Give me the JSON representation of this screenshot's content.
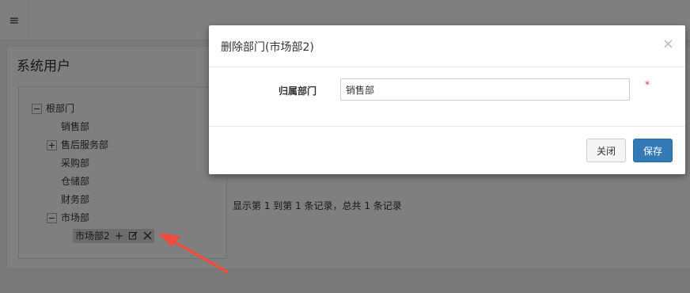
{
  "topbar": {
    "menu_icon": "hamburger-icon",
    "menu_glyph": "≡"
  },
  "page": {
    "title": "系统用户"
  },
  "tree": {
    "root": "根部门",
    "items": [
      "销售部",
      "售后服务部",
      "采购部",
      "仓储部",
      "财务部",
      "市场部"
    ],
    "selected_child": "市场部2"
  },
  "list": {
    "info": "显示第 1 到第 1 条记录，总共 1 条记录"
  },
  "modal": {
    "title": "删除部门(市场部2)",
    "close_glyph": "×",
    "field_label": "归属部门",
    "field_value": "销售部",
    "required_mark": "*",
    "close_button": "关闭",
    "save_button": "保存"
  },
  "colors": {
    "primary": "#337ab7",
    "required": "#e4393c",
    "arrow": "#ee4c3f"
  }
}
